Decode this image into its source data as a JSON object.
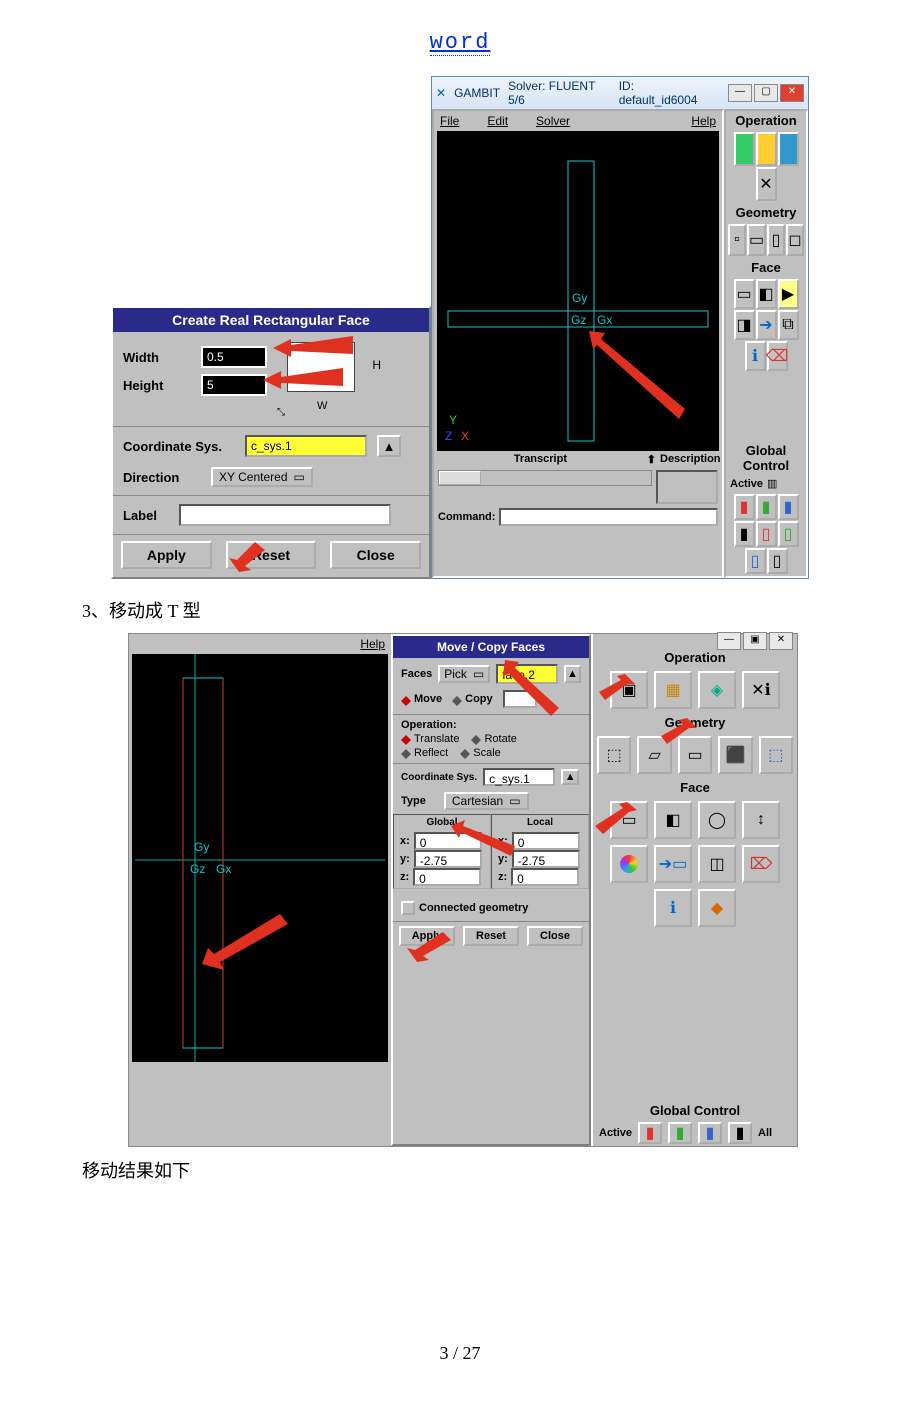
{
  "header": {
    "word": "word"
  },
  "dialog1": {
    "title": "Create Real Rectangular Face",
    "width_label": "Width",
    "width_value": "0.5",
    "height_label": "Height",
    "height_value": "5",
    "h_marker": "H",
    "w_marker": "W",
    "coord_label": "Coordinate Sys.",
    "coord_value": "c_sys.1",
    "direction_label": "Direction",
    "direction_value": "XY Centered",
    "label_label": "Label",
    "label_value": "",
    "apply": "Apply",
    "reset": "Reset",
    "close": "Close"
  },
  "gambit1": {
    "title_app": "GAMBIT",
    "title_solver": "Solver: FLUENT 5/6",
    "title_id": "ID: default_id6004",
    "file": "File",
    "edit": "Edit",
    "solver": "Solver",
    "help": "Help",
    "operation": "Operation",
    "geometry": "Geometry",
    "face": "Face",
    "global_control": "Global Control",
    "active": "Active",
    "transcript": "Transcript",
    "description": "Description",
    "command": "Command:",
    "gy": "Gy",
    "gz": "Gz",
    "gx": "Gx",
    "y": "Y",
    "x": "X",
    "z": "Z"
  },
  "caption1": "3、移动成 T 型",
  "gambit2": {
    "help": "Help",
    "operation": "Operation",
    "geometry": "Geometry",
    "face": "Face",
    "global_control": "Global Control",
    "active": "Active",
    "all": "All",
    "gy": "Gy",
    "gz": "Gz",
    "gx": "Gx"
  },
  "dialog2": {
    "title": "Move / Copy Faces",
    "faces_label": "Faces",
    "pick": "Pick",
    "faces_value": "face.2",
    "move": "Move",
    "copy": "Copy",
    "copy_value": "",
    "op_label": "Operation:",
    "translate": "Translate",
    "rotate": "Rotate",
    "reflect": "Reflect",
    "scale": "Scale",
    "coord_label": "Coordinate Sys.",
    "coord_value": "c_sys.1",
    "type_label": "Type",
    "type_value": "Cartesian",
    "global_col": "Global",
    "local_col": "Local",
    "x_label": "x:",
    "y_label": "y:",
    "z_label": "z:",
    "gx": "0",
    "gy": "-2.75",
    "gz": "0",
    "lx": "0",
    "ly": "-2.75",
    "lz": "0",
    "connected": "Connected geometry",
    "apply": "Apply",
    "reset": "Reset",
    "close": "Close"
  },
  "caption2": "移动结果如下",
  "pagenum": "3 / 27"
}
